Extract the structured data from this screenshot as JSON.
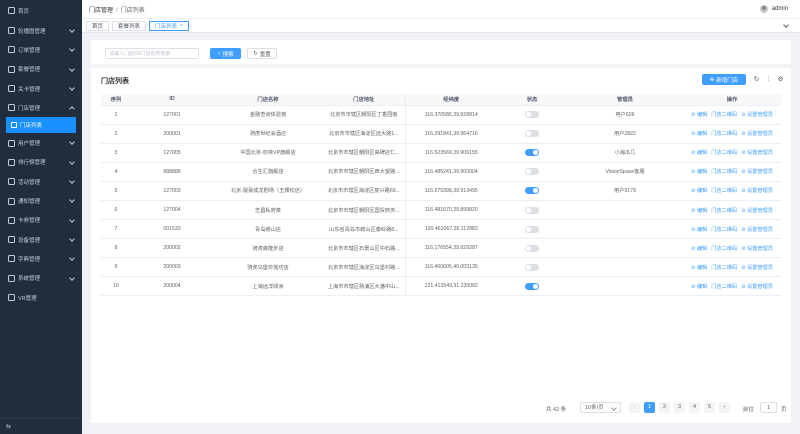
{
  "sidebar": {
    "items": [
      {
        "label": "首页",
        "expandable": false
      },
      {
        "label": "轮播图管理",
        "expandable": true
      },
      {
        "label": "订单管理",
        "expandable": true
      },
      {
        "label": "套餐管理",
        "expandable": true
      },
      {
        "label": "关卡管理",
        "expandable": true
      },
      {
        "label": "门店管理",
        "expandable": true,
        "expanded": true
      },
      {
        "label": "用户管理",
        "expandable": true
      },
      {
        "label": "排行榜管理",
        "expandable": true
      },
      {
        "label": "活动管理",
        "expandable": true
      },
      {
        "label": "通知管理",
        "expandable": true
      },
      {
        "label": "卡券管理",
        "expandable": true
      },
      {
        "label": "设备管理",
        "expandable": true
      },
      {
        "label": "字典管理",
        "expandable": true
      },
      {
        "label": "系统管理",
        "expandable": true
      },
      {
        "label": "VR管理",
        "expandable": false
      }
    ],
    "active_sub": "门店列表",
    "collapse_icon": "⇆"
  },
  "header": {
    "breadcrumb": [
      "门店管理",
      "门店列表"
    ],
    "breadcrumb_sep": "/",
    "username": "admin"
  },
  "tabs": [
    {
      "label": "首页",
      "active": false
    },
    {
      "label": "套餐列表",
      "active": false
    },
    {
      "label": "门店列表",
      "active": true,
      "closable": "×"
    }
  ],
  "search": {
    "placeholder": "请输入门店ID/门店名称搜索",
    "search_label": "搜索",
    "search_icon": "○",
    "reset_label": "重置",
    "reset_icon": "↻"
  },
  "card": {
    "title": "门店列表",
    "add_label": "新增门店",
    "add_icon": "⊕",
    "refresh_icon": "↻",
    "column_icon": "⫶",
    "settings_icon": "⚙"
  },
  "table": {
    "headers": [
      "序列",
      "ID",
      "门店名称",
      "门店地址",
      "经纬度",
      "状态",
      "管理员",
      "操作"
    ],
    "op_labels": [
      "⊘ 编辑",
      "门店二维码",
      "⊘ 设置管理员"
    ],
    "rows": [
      {
        "seq": "1",
        "id": "127001",
        "name": "金融查询体验馆",
        "address": "北京市市辖区朝阳区丁香园南",
        "coords": "116.370586,39.928814",
        "status": false,
        "admin": "用户626"
      },
      {
        "seq": "2",
        "id": "200001",
        "name": "骑虎世纪会酒店",
        "address": "北京市市辖区海淀区远大路1...",
        "coords": "116.291841,39.964716",
        "status": false,
        "admin": "用户2822"
      },
      {
        "seq": "3",
        "id": "127005",
        "name": "中国北京-欢咏VP旗舰店",
        "address": "北京市市辖区朝阳区高碑店仁...",
        "coords": "116.523569,39.906155",
        "status": true,
        "admin": "小海瓜几"
      },
      {
        "seq": "4",
        "id": "888888",
        "name": "合生汇旗舰店",
        "address": "北京市市辖区朝阳区西大望路...",
        "coords": "116.485241,39.900004",
        "status": false,
        "admin": "VisionSpace客服"
      },
      {
        "seq": "5",
        "id": "127003",
        "name": "北京-骏豪成龙剧场（五棵松店）",
        "address": "北京市市辖区海淀区复兴路69...",
        "coords": "116.279398,39.913495",
        "status": true,
        "admin": "用户9179"
      },
      {
        "seq": "6",
        "id": "127004",
        "name": "芝昌私府菜",
        "address": "北京市市辖区朝阳区国贸商务...",
        "coords": "116.481670,39.899820",
        "status": false,
        "admin": ""
      },
      {
        "seq": "7",
        "id": "001533",
        "name": "青岛崂山店",
        "address": "山东省青岛市崂山区秦岭路8...",
        "coords": "120.461067,36.112883",
        "status": false,
        "admin": ""
      },
      {
        "seq": "8",
        "id": "200002",
        "name": "骑虎森隆步店",
        "address": "北京市市辖区石景山区中石路...",
        "coords": "116.176554,39.929287",
        "status": false,
        "admin": ""
      },
      {
        "seq": "9",
        "id": "200003",
        "name": "骑虎乌堡珍馐坊店",
        "address": "北京市市辖区海淀区乌堡村路...",
        "coords": "116.400605,40.003135",
        "status": false,
        "admin": ""
      },
      {
        "seq": "10",
        "id": "200004",
        "name": "上海远洋绿洲",
        "address": "上海市市辖区杨浦区大潘中山...",
        "coords": "121.413549,31.235082",
        "status": true,
        "admin": ""
      }
    ]
  },
  "pagination": {
    "total": "共 42 条",
    "page_size": "10条/页",
    "prev": "‹",
    "next": "›",
    "pages": [
      "1",
      "2",
      "3",
      "4",
      "5"
    ],
    "current": "1",
    "goto_label": "前往",
    "goto_value": "1",
    "goto_suffix": "页"
  }
}
